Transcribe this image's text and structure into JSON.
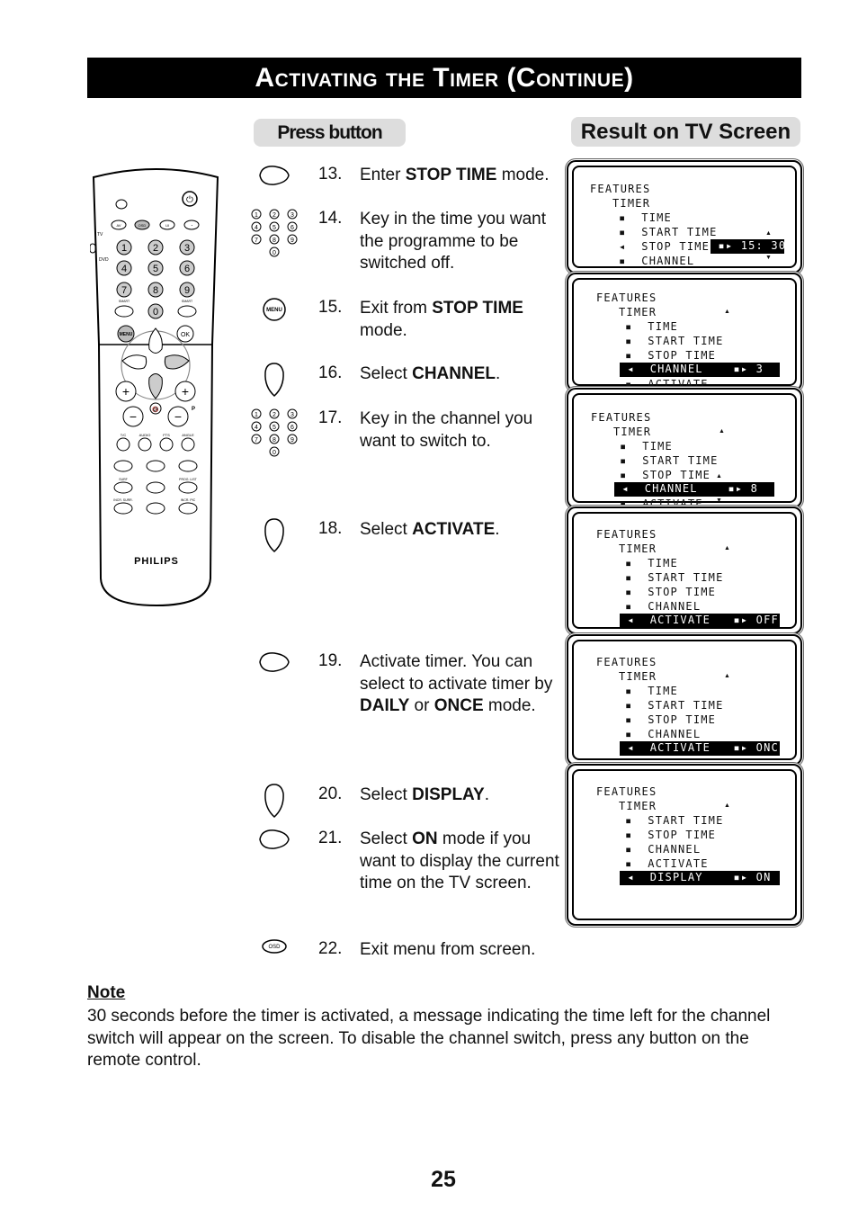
{
  "title": "Activating the Timer (Continue)",
  "headers": {
    "press_button": "Press button",
    "result": "Result on TV Screen"
  },
  "remote": {
    "brand": "PHILIPS",
    "switch_labels": [
      "TV",
      "DVD"
    ],
    "top_row": [
      "AV",
      "OSD",
      "I-II",
      "sleep"
    ],
    "digits": [
      "1",
      "2",
      "3",
      "4",
      "5",
      "6",
      "7",
      "8",
      "9",
      "0"
    ],
    "smart_label": "SMART",
    "menu_label": "MENU",
    "ok_label": "OK",
    "p_label": "P",
    "function_labels": [
      "T/C",
      "AUDIO",
      "FTS",
      "ANGLE"
    ],
    "row3_labels": [
      "SURF",
      "",
      "PROG. LIST"
    ],
    "row4_labels": [
      "INCR. SURR.",
      "",
      "INCR. PIC"
    ]
  },
  "steps": [
    {
      "num": "13.",
      "pre": "Enter ",
      "bold": "STOP TIME",
      "post": " mode.",
      "icon": "right-arrow-button"
    },
    {
      "num": "14.",
      "pre": "Key in the time you want the programme to be switched off.",
      "bold": "",
      "post": "",
      "icon": "digit-keypad"
    },
    {
      "num": "15.",
      "pre": "Exit from ",
      "bold": "STOP TIME",
      "post": " mode.",
      "icon": "menu-button"
    },
    {
      "num": "16.",
      "pre": "Select ",
      "bold": "CHANNEL",
      "post": ".",
      "icon": "down-arrow-button"
    },
    {
      "num": "17.",
      "pre": "Key in the channel you want to switch to.",
      "bold": "",
      "post": "",
      "icon": "digit-keypad"
    },
    {
      "num": "18.",
      "pre": "Select ",
      "bold": "ACTIVATE",
      "post": ".",
      "icon": "down-arrow-button"
    },
    {
      "num": "19.",
      "pre": "Activate timer. You can select to activate timer by ",
      "bold": "DAILY",
      "mid": " or ",
      "bold2": "ONCE",
      "post": " mode.",
      "icon": "right-arrow-button"
    },
    {
      "num": "20.",
      "pre": "Select ",
      "bold": "DISPLAY",
      "post": ".",
      "icon": "down-arrow-button"
    },
    {
      "num": "21.",
      "pre": "Select ",
      "bold": "ON",
      "post": " mode if you want to display the current time on the TV screen.",
      "icon": "right-arrow-button"
    },
    {
      "num": "22.",
      "pre": "Exit menu from screen.",
      "bold": "",
      "post": "",
      "icon": "osd-button"
    }
  ],
  "keypad_digits": [
    "1",
    "2",
    "3",
    "4",
    "5",
    "6",
    "7",
    "8",
    "9",
    "0"
  ],
  "screens": [
    {
      "header": "FEATURES",
      "sub": "TIMER",
      "items": [
        "TIME",
        "START TIME"
      ],
      "selected": "STOP TIME",
      "value": "15: 30",
      "after": [
        "CHANNEL"
      ]
    },
    {
      "header": "FEATURES",
      "sub": "TIMER",
      "items": [
        "TIME",
        "START TIME",
        "STOP TIME"
      ],
      "selected": "CHANNEL",
      "value": "3",
      "after": [
        "ACTIVATE"
      ]
    },
    {
      "header": "FEATURES",
      "sub": "TIMER",
      "items": [
        "TIME",
        "START TIME",
        "STOP TIME"
      ],
      "selected": "CHANNEL",
      "value": "8",
      "after": [
        "ACTIVATE"
      ]
    },
    {
      "header": "FEATURES",
      "sub": "TIMER",
      "items": [
        "TIME",
        "START TIME",
        "STOP TIME",
        "CHANNEL"
      ],
      "selected": "ACTIVATE",
      "value": "OFF",
      "after": []
    },
    {
      "header": "FEATURES",
      "sub": "TIMER",
      "items": [
        "TIME",
        "START TIME",
        "STOP TIME",
        "CHANNEL"
      ],
      "selected": "ACTIVATE",
      "value": "ONCE",
      "after": []
    },
    {
      "header": "FEATURES",
      "sub": "TIMER",
      "items": [
        "START TIME",
        "STOP TIME",
        "CHANNEL",
        "ACTIVATE"
      ],
      "selected": "DISPLAY",
      "value": "ON",
      "after": []
    }
  ],
  "note": {
    "title": "Note",
    "body": "30 seconds before the timer is activated, a message indicating the time left for the channel switch will appear on the screen. To disable the channel switch, press any button on the remote control."
  },
  "page_number": "25"
}
